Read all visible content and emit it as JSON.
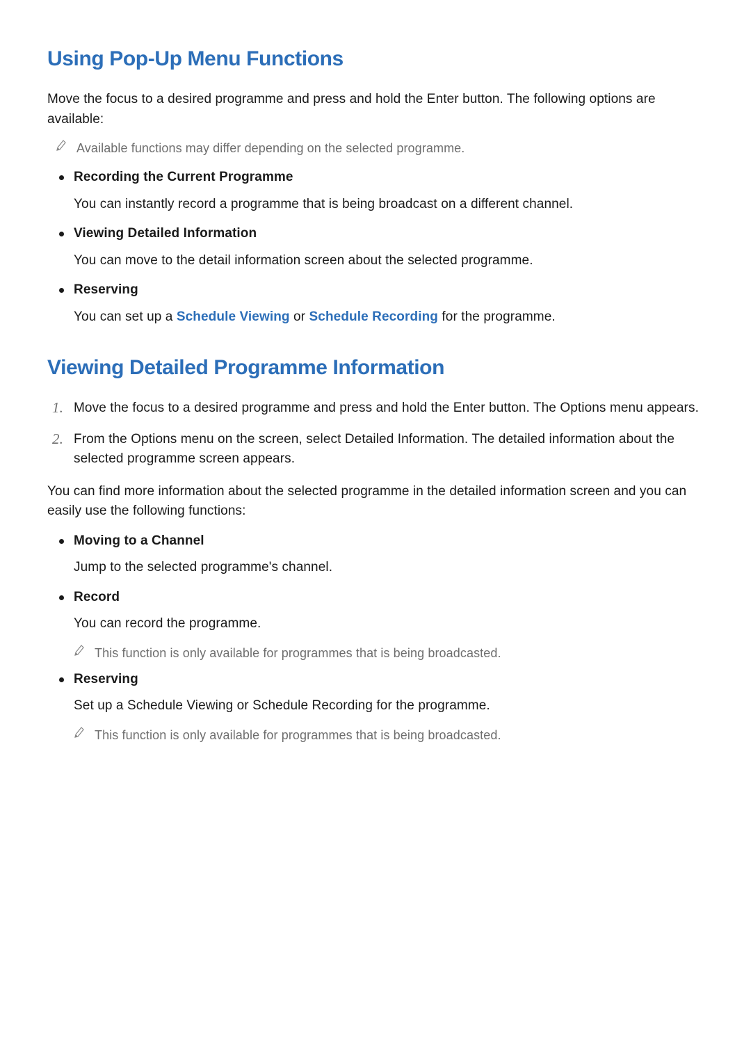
{
  "colors": {
    "accent": "#2c6eb8"
  },
  "section1": {
    "title": "Using Pop-Up Menu Functions",
    "intro": "Move the focus to a desired programme and press and hold the Enter button. The following options are available:",
    "note": "Available functions may differ depending on the selected programme.",
    "items": [
      {
        "title": "Recording the Current Programme",
        "desc": "You can instantly record a programme that is being broadcast on a different channel."
      },
      {
        "title": "Viewing Detailed Information",
        "desc": "You can move to the detail information screen about the selected programme."
      },
      {
        "title": "Reserving",
        "desc_pre": "You can set up a ",
        "link1": "Schedule Viewing",
        "desc_mid": " or ",
        "link2": "Schedule Recording",
        "desc_post": " for the programme."
      }
    ]
  },
  "section2": {
    "title": "Viewing Detailed Programme Information",
    "steps": [
      "Move the focus to a desired programme and press and hold the Enter button. The Options menu appears.",
      "From the Options menu on the screen, select Detailed Information. The detailed information about the selected programme screen appears."
    ],
    "after_steps": "You can find more information about the selected programme in the detailed information screen and you can easily use the following functions:",
    "items": [
      {
        "title": "Moving to a Channel",
        "desc": "Jump to the selected programme's channel."
      },
      {
        "title": "Record",
        "desc": "You can record the programme.",
        "note": "This function is only available for programmes that is being broadcasted."
      },
      {
        "title": "Reserving",
        "desc": "Set up a Schedule Viewing or Schedule Recording for the programme.",
        "note": "This function is only available for programmes that is being broadcasted."
      }
    ]
  }
}
